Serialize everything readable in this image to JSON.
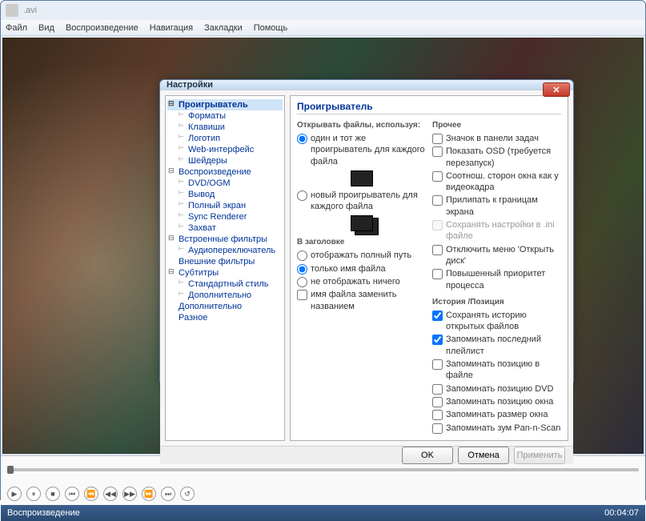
{
  "window": {
    "title": ".avi"
  },
  "menubar": [
    "Файл",
    "Вид",
    "Воспроизведение",
    "Навигация",
    "Закладки",
    "Помощь"
  ],
  "transport_icons": [
    "▶",
    "⏸",
    "■",
    "⏮",
    "⏪",
    "◀◀",
    "▶▶",
    "⏩",
    "⏭",
    "↺"
  ],
  "statusbar": {
    "left": "Воспроизведение",
    "right": "00:04:07"
  },
  "dialog": {
    "title": "Настройки",
    "close": "✕",
    "tree": [
      {
        "label": "Проигрыватель",
        "type": "parent",
        "sel": true
      },
      {
        "label": "Форматы",
        "type": "child"
      },
      {
        "label": "Клавиши",
        "type": "child"
      },
      {
        "label": "Логотип",
        "type": "child"
      },
      {
        "label": "Web-интерфейс",
        "type": "child"
      },
      {
        "label": "Шейдеры",
        "type": "child"
      },
      {
        "label": "Воспроизведение",
        "type": "parent"
      },
      {
        "label": "DVD/OGM",
        "type": "child"
      },
      {
        "label": "Вывод",
        "type": "child"
      },
      {
        "label": "Полный экран",
        "type": "child"
      },
      {
        "label": "Sync Renderer",
        "type": "child"
      },
      {
        "label": "Захват",
        "type": "child"
      },
      {
        "label": "Встроенные фильтры",
        "type": "parent"
      },
      {
        "label": "Аудиопереключатель",
        "type": "child"
      },
      {
        "label": "Внешние фильтры",
        "type": "plain"
      },
      {
        "label": "Субтитры",
        "type": "parent"
      },
      {
        "label": "Стандартный стиль",
        "type": "child"
      },
      {
        "label": "Дополнительно",
        "type": "child"
      },
      {
        "label": "Дополнительно",
        "type": "plain"
      },
      {
        "label": "Разное",
        "type": "plain"
      }
    ],
    "content": {
      "heading": "Проигрыватель",
      "open_group": {
        "title": "Открывать файлы, используя:",
        "r1": "один и тот же проигрыватель для каждого файла",
        "r2": "новый проигрыватель для каждого файла"
      },
      "other_group": {
        "title": "Прочее",
        "items": [
          {
            "label": "Значок в панели задач",
            "checked": false
          },
          {
            "label": "Показать OSD (требуется перезапуск)",
            "checked": false
          },
          {
            "label": "Соотнош. сторон окна как у видеокадра",
            "checked": false
          },
          {
            "label": "Прилипать к границам экрана",
            "checked": false
          },
          {
            "label": "Сохранять настройки в .ini файле",
            "checked": false,
            "disabled": true
          },
          {
            "label": "Отключить меню 'Открыть диск'",
            "checked": false
          },
          {
            "label": "Повышенный приоритет процесса",
            "checked": false
          }
        ]
      },
      "title_group": {
        "title": "В заголовке",
        "r1": "отображать полный путь",
        "r2": "только имя файла",
        "r3": "не отображать ничего",
        "c1": "имя файла заменить названием"
      },
      "history_group": {
        "title": "История /Позиция",
        "items": [
          {
            "label": "Сохранять историю открытых файлов",
            "checked": true
          },
          {
            "label": "Запоминать последний плейлист",
            "checked": true
          },
          {
            "label": "Запоминать позицию в файле",
            "checked": false
          },
          {
            "label": "Запоминать позицию DVD",
            "checked": false
          },
          {
            "label": "Запоминать позицию окна",
            "checked": false
          },
          {
            "label": "Запоминать размер окна",
            "checked": false
          },
          {
            "label": "Запоминать зум Pan-n-Scan",
            "checked": false
          }
        ]
      }
    },
    "buttons": {
      "ok": "OK",
      "cancel": "Отмена",
      "apply": "Применить"
    }
  }
}
